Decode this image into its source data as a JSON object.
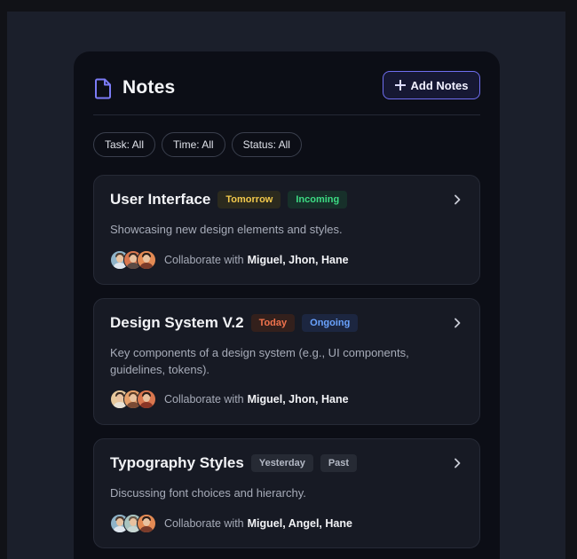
{
  "header": {
    "title": "Notes",
    "add_label": "Add Notes"
  },
  "filters": [
    {
      "label": "Task: All"
    },
    {
      "label": "Time: All"
    },
    {
      "label": "Status: All"
    }
  ],
  "notes": [
    {
      "title": "User Interface",
      "time_tag": "Tomorrow",
      "status_tag": "Incoming",
      "description": "Showcasing new design elements and styles.",
      "collab_prefix": "Collaborate with",
      "collaborators": "Miguel, Jhon, Hane"
    },
    {
      "title": "Design System V.2",
      "time_tag": "Today",
      "status_tag": "Ongoing",
      "description": "Key components of a design system (e.g., UI components, guidelines, tokens).",
      "collab_prefix": "Collaborate with",
      "collaborators": "Miguel, Jhon, Hane"
    },
    {
      "title": "Typography Styles",
      "time_tag": "Yesterday",
      "status_tag": "Past",
      "description": "Discussing font choices and hierarchy.",
      "collab_prefix": "Collaborate with",
      "collaborators": "Miguel, Angel, Hane"
    }
  ],
  "icons": {
    "header": "document-icon",
    "add": "plus-icon",
    "open": "chevron-right-icon"
  },
  "colors": {
    "accent": "#6f6ef0",
    "tomorrow": "#f2c94c",
    "incoming": "#3ddc84",
    "today": "#f2734d",
    "ongoing": "#6aa3ff",
    "past": "#9aa0ad"
  }
}
